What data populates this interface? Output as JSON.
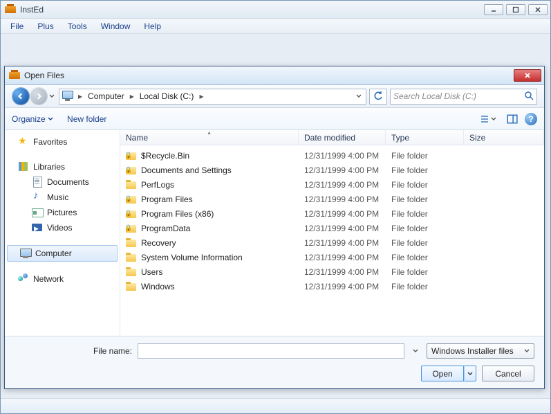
{
  "app": {
    "title": "InstEd",
    "menus": [
      "File",
      "Plus",
      "Tools",
      "Window",
      "Help"
    ]
  },
  "dialog": {
    "title": "Open Files",
    "breadcrumb": {
      "root": "Computer",
      "drive": "Local Disk (C:)"
    },
    "search_placeholder": "Search Local Disk (C:)",
    "toolbar": {
      "organize": "Organize",
      "new_folder": "New folder"
    },
    "columns": {
      "name": "Name",
      "date": "Date modified",
      "type": "Type",
      "size": "Size"
    },
    "navpane": {
      "favorites": "Favorites",
      "libraries": "Libraries",
      "documents": "Documents",
      "music": "Music",
      "pictures": "Pictures",
      "videos": "Videos",
      "computer": "Computer",
      "network": "Network"
    },
    "files": [
      {
        "name": "$Recycle.Bin",
        "date": "12/31/1999 4:00 PM",
        "type": "File folder",
        "locked": true
      },
      {
        "name": "Documents and Settings",
        "date": "12/31/1999 4:00 PM",
        "type": "File folder",
        "locked": true
      },
      {
        "name": "PerfLogs",
        "date": "12/31/1999 4:00 PM",
        "type": "File folder",
        "locked": false
      },
      {
        "name": "Program Files",
        "date": "12/31/1999 4:00 PM",
        "type": "File folder",
        "locked": true
      },
      {
        "name": "Program Files (x86)",
        "date": "12/31/1999 4:00 PM",
        "type": "File folder",
        "locked": true
      },
      {
        "name": "ProgramData",
        "date": "12/31/1999 4:00 PM",
        "type": "File folder",
        "locked": true
      },
      {
        "name": "Recovery",
        "date": "12/31/1999 4:00 PM",
        "type": "File folder",
        "locked": false
      },
      {
        "name": "System Volume Information",
        "date": "12/31/1999 4:00 PM",
        "type": "File folder",
        "locked": false
      },
      {
        "name": "Users",
        "date": "12/31/1999 4:00 PM",
        "type": "File folder",
        "locked": false
      },
      {
        "name": "Windows",
        "date": "12/31/1999 4:00 PM",
        "type": "File folder",
        "locked": false
      }
    ],
    "footer": {
      "filename_label": "File name:",
      "filename_value": "",
      "filter": "Windows Installer files",
      "open": "Open",
      "cancel": "Cancel"
    }
  }
}
